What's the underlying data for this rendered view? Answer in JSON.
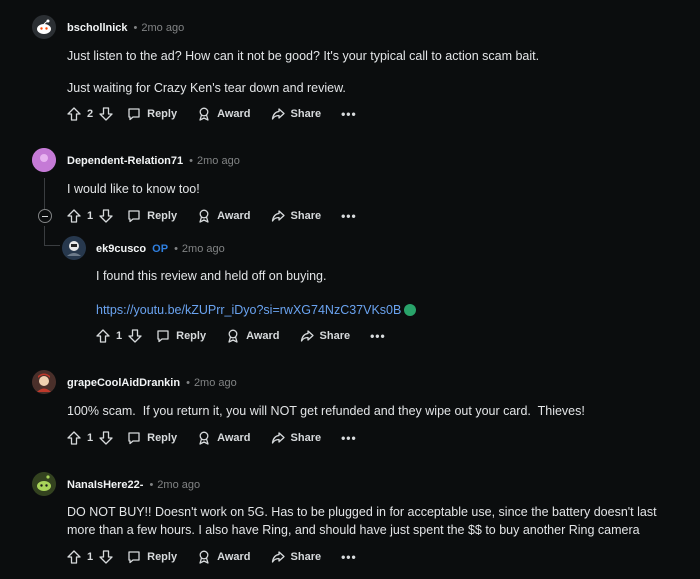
{
  "labels": {
    "reply": "Reply",
    "award": "Award",
    "share": "Share",
    "more": "•••"
  },
  "comments": [
    {
      "author": "bschollnick",
      "time": "2mo ago",
      "lines": [
        "Just listen to the ad? How can it not be good? It's your typical call to action scam bait.",
        "Just waiting for Crazy Ken's tear down and review."
      ],
      "votes": "2"
    },
    {
      "author": "Dependent-Relation71",
      "time": "2mo ago",
      "lines": [
        "I would like to know too!"
      ],
      "votes": "1"
    },
    {
      "author": "ek9cusco",
      "badge": "OP",
      "time": "2mo ago",
      "lines": [
        "I found this review and held off on buying."
      ],
      "link": "https://youtu.be/kZUPrr_iDyo?si=rwXG74NzC37VKs0B",
      "votes": "1"
    },
    {
      "author": "grapeCoolAidDrankin",
      "time": "2mo ago",
      "lines": [
        "100% scam.  If you return it, you will NOT get refunded and they wipe out your card.  Thieves!"
      ],
      "votes": "1"
    },
    {
      "author": "NanaIsHere22-",
      "time": "2mo ago",
      "lines": [
        "DO NOT BUY!! Doesn't work on 5G. Has to be plugged in for acceptable use, since the battery doesn't last more than a few hours. I also have Ring, and should have just spent the $$ to buy another Ring camera"
      ],
      "votes": "1"
    }
  ],
  "colors": {
    "background": "#0b0d0e",
    "text": "#d7dadc",
    "muted": "#818384",
    "link": "#6aa3f0",
    "op": "#2f7fe0"
  }
}
